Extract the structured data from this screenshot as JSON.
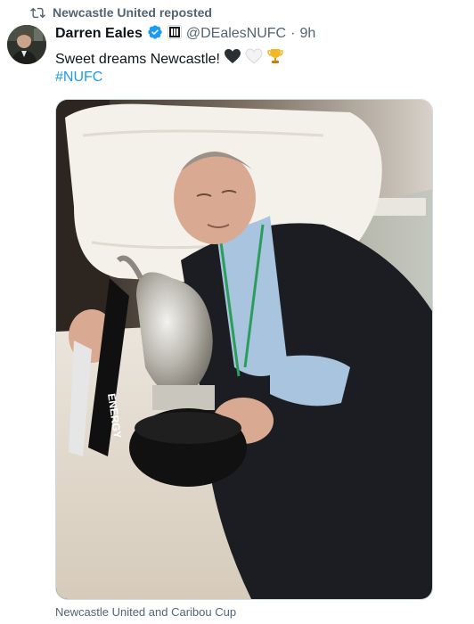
{
  "repost": {
    "icon": "repost-icon",
    "text": "Newcastle United reposted"
  },
  "author": {
    "name": "Darren Eales",
    "handle": "@DEalesNUFC",
    "separator": "·",
    "time": "9h",
    "verified_color": "#1d9bf0",
    "affiliate_badge": "newcastle-crest-icon"
  },
  "tweet": {
    "text": "Sweet dreams Newcastle!",
    "emojis": [
      "black-heart-icon",
      "white-heart-icon",
      "trophy-icon"
    ],
    "hashtag": "#NUFC"
  },
  "media": {
    "description_icon": "photo-man-sleeping-with-trophy",
    "ribbon_text": "ENERGY"
  },
  "caption": "Newcastle United and Caribou Cup",
  "colors": {
    "link": "#1d9bf0",
    "secondary_text": "#536471",
    "primary_text": "#0f1419"
  }
}
